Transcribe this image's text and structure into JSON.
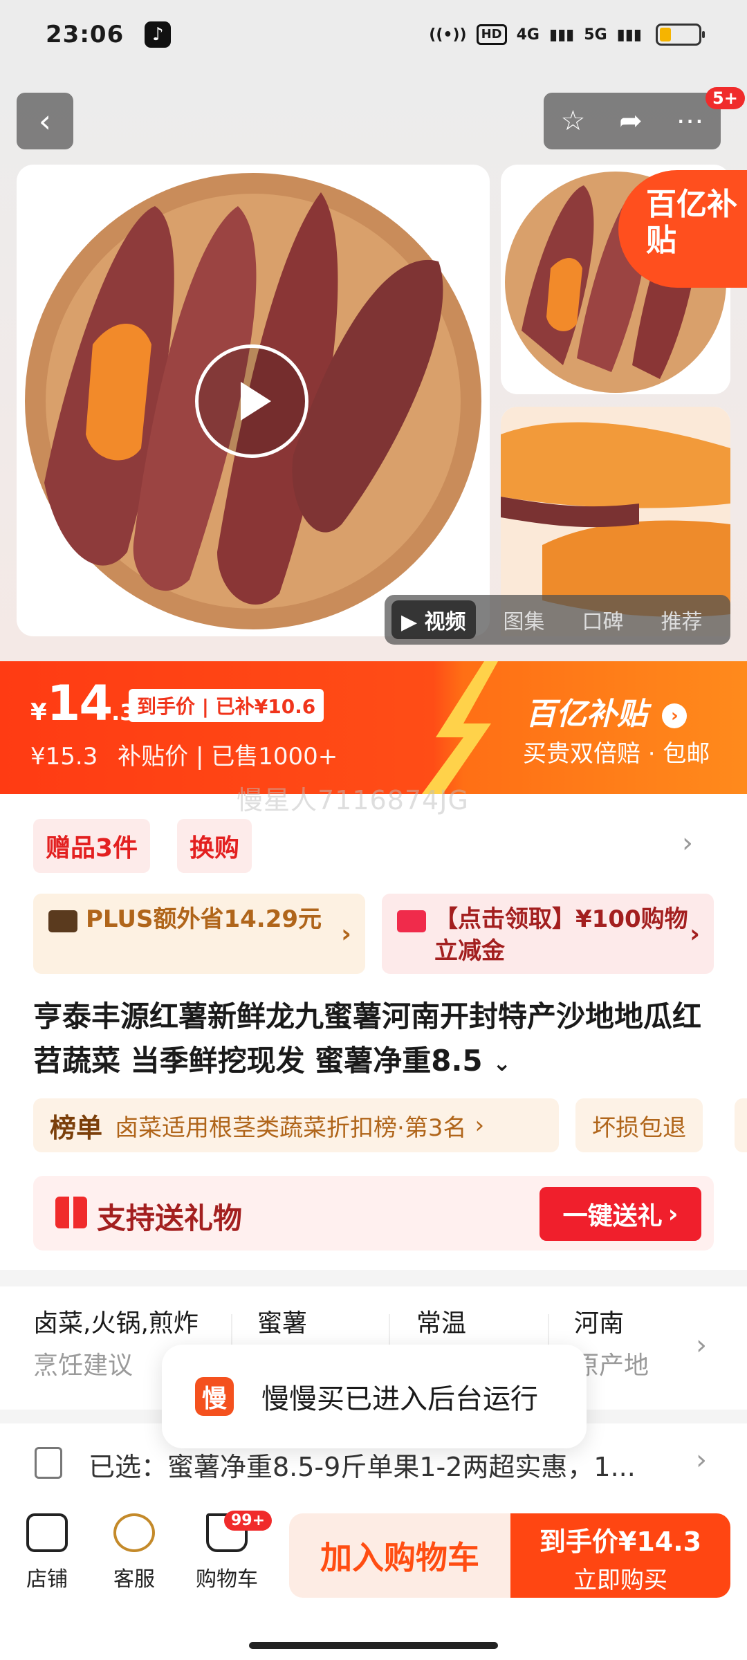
{
  "status_bar": {
    "time": "23:06",
    "network": "HD",
    "signal1": "4G",
    "signal2": "5G"
  },
  "gallery": {
    "media_tabs": [
      "视频",
      "图集",
      "口碑",
      "推荐"
    ],
    "active_tab": "视频",
    "corner_badge": "百亿补贴",
    "message_badge": "5+"
  },
  "price_banner": {
    "currency": "¥",
    "price_int": "14",
    "price_dec": ".3",
    "arrival_tag": "到手价 | 已补¥10.6",
    "original_price": "¥15.3",
    "sub_text": "补贴价 | 已售1000+",
    "brand": "百亿补贴",
    "brand_note": "买贵双倍赔 · 包邮"
  },
  "watermark": "慢星人7116874JG",
  "chips": [
    "赠品3件",
    "换购"
  ],
  "promos": {
    "plus": "PLUS额外省14.29元",
    "coupon": "【点击领取】¥100购物立减金"
  },
  "product_title": "亨泰丰源红薯新鲜龙九蜜薯河南开封特产沙地地瓜红苕蔬菜 当季鲜挖现发 蜜薯净重8.5",
  "rank": {
    "label": "榜单",
    "text": "卤菜适用根茎类蔬菜折扣榜·第3名"
  },
  "tags": [
    "坏损包退"
  ],
  "gift": {
    "text": "支持送礼物",
    "button": "一键送礼"
  },
  "attributes": [
    {
      "value": "卤菜,火锅,煎炸",
      "key": "烹饪建议"
    },
    {
      "value": "蜜薯",
      "key": ""
    },
    {
      "value": "常温",
      "key": ""
    },
    {
      "value": "河南",
      "key": "原产地"
    }
  ],
  "selected": "已选：蜜薯净重8.5-9斤单果1-2两超实惠，1...",
  "toast": {
    "logo": "慢",
    "message": "慢慢买已进入后台运行"
  },
  "bottom_nav": [
    {
      "label": "店铺"
    },
    {
      "label": "客服"
    },
    {
      "label": "购物车"
    }
  ],
  "cart_badge": "99+",
  "buttons": {
    "add_cart": "加入购物车",
    "buy_line1": "到手价¥14.3",
    "buy_line2": "立即购买"
  },
  "colors": {
    "accent": "#ff4612",
    "banner_start": "#ff3b13",
    "banner_end": "#ff8a1c",
    "gift_button": "#f01f2c"
  }
}
